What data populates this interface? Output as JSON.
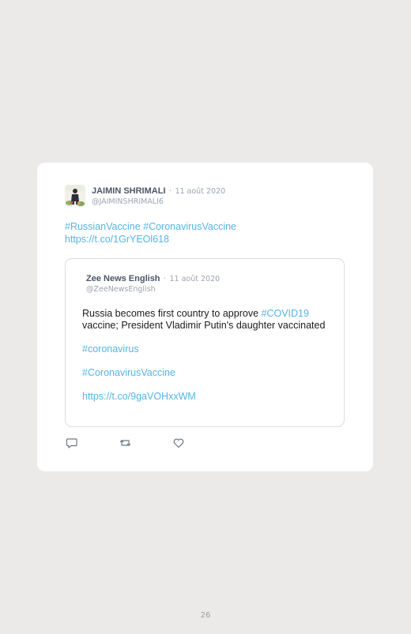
{
  "tweet": {
    "author_name": "JAIMIN SHRIMALI",
    "separator": "·",
    "date": "11 août 2020",
    "handle": "@JAIMINSHRIMALI6",
    "text_lines": [
      "#RussianVaccine #CoronavirusVaccine",
      "https://t.co/1GrYEOl618"
    ]
  },
  "quoted_tweet": {
    "author_name": "Zee News English",
    "separator": "·",
    "date": "11 août 2020",
    "handle": "@ZeeNewsEnglish",
    "text_before": "Russia becomes first country to approve ",
    "text_tag": "#COVID19",
    "text_after": " vaccine; President Vladimir Putin's daughter vaccinated",
    "links": [
      "#coronavirus",
      "#CoronavirusVaccine",
      "https://t.co/9gaVOHxxWM"
    ]
  },
  "actions": {
    "reply_icon": "reply-icon",
    "retweet_icon": "retweet-icon",
    "like_icon": "heart-icon"
  },
  "colors": {
    "link": "#55b4e6",
    "meta": "#9aa4b0",
    "background": "#ebeae8",
    "card": "#ffffff"
  },
  "page": {
    "number": "26"
  }
}
